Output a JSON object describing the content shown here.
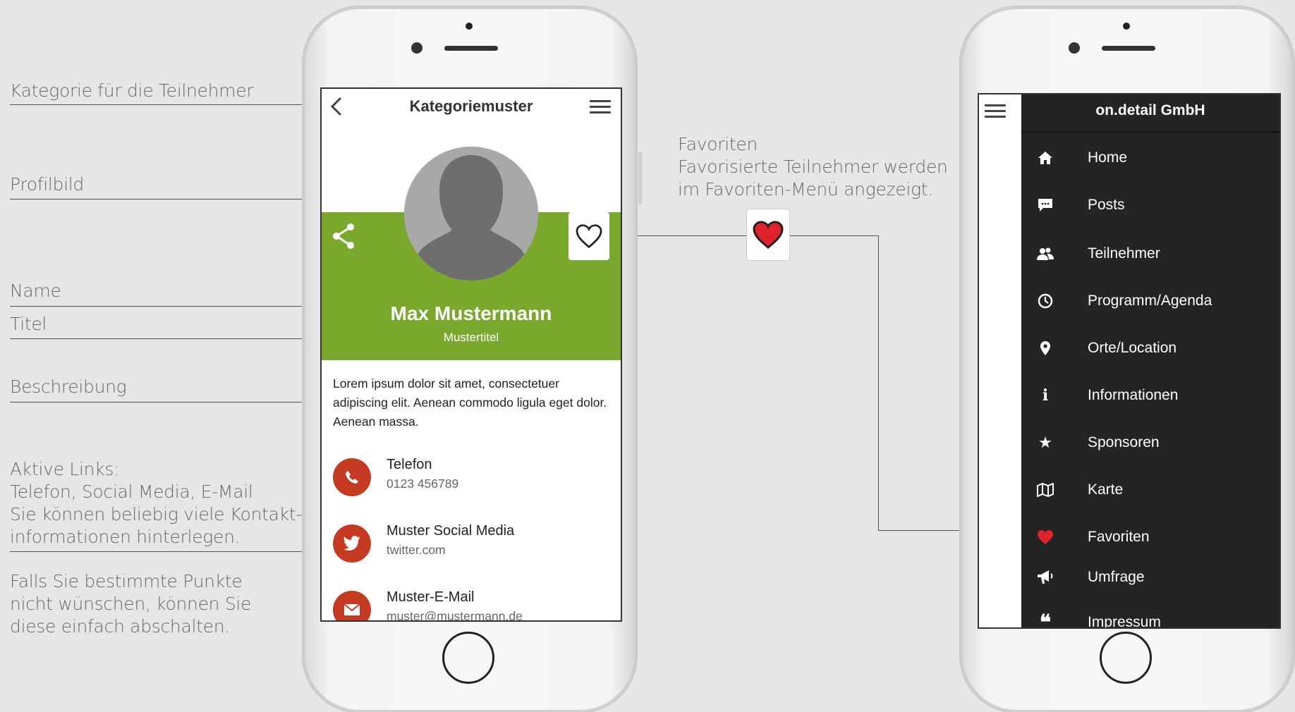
{
  "annotations": {
    "kategorie": "Kategorie für die Teilnehmer",
    "profilbild": "Profilbild",
    "name": "Name",
    "titel": "Titel",
    "beschreibung": "Beschreibung",
    "links_1": "Aktive Links:",
    "links_2": "Telefon, Social Media, E-Mail",
    "links_3": "Sie können beliebig viele Kontakt-",
    "links_4": "informationen hinterlegen.",
    "hint_1": "Falls Sie bestimmte Punkte",
    "hint_2": "nicht wünschen, können Sie",
    "hint_3": "diese einfach abschalten.",
    "fav_1": "Favoriten",
    "fav_2": "Favorisierte Teilnehmer werden",
    "fav_3": "im Favoriten-Menü angezeigt."
  },
  "profile": {
    "header_title": "Kategoriemuster",
    "name": "Max Mustermann",
    "title": "Mustertitel",
    "description": "Lorem ipsum dolor sit amet, consectetuer adipiscing elit. Aenean commodo ligula eget dolor. Aenean massa.",
    "contacts": [
      {
        "label": "Telefon",
        "value": "0123 456789",
        "icon": "phone-icon"
      },
      {
        "label": "Muster Social Media",
        "value": "twitter.com",
        "icon": "twitter-icon"
      },
      {
        "label": "Muster-E-Mail",
        "value": "muster@mustermann.de",
        "icon": "mail-icon"
      }
    ]
  },
  "menu": {
    "title": "on.detail GmbH",
    "items": [
      {
        "label": "Home",
        "icon": "home-icon"
      },
      {
        "label": "Posts",
        "icon": "chat-icon"
      },
      {
        "label": "Teilnehmer",
        "icon": "users-icon"
      },
      {
        "label": "Programm/Agenda",
        "icon": "clock-icon"
      },
      {
        "label": "Orte/Location",
        "icon": "pin-icon"
      },
      {
        "label": "Informationen",
        "icon": "info-icon"
      },
      {
        "label": "Sponsoren",
        "icon": "star-icon"
      },
      {
        "label": "Karte",
        "icon": "map-icon"
      },
      {
        "label": "Favoriten",
        "icon": "heart-icon"
      },
      {
        "label": "Umfrage",
        "icon": "megaphone-icon"
      },
      {
        "label": "Impressum",
        "icon": "quote-icon"
      }
    ]
  },
  "colors": {
    "background": "#e6e6e6",
    "profile_green": "#79a82c",
    "contact_red": "#c53a22",
    "menu_dark": "#242424",
    "heart_red": "#e0232b"
  }
}
